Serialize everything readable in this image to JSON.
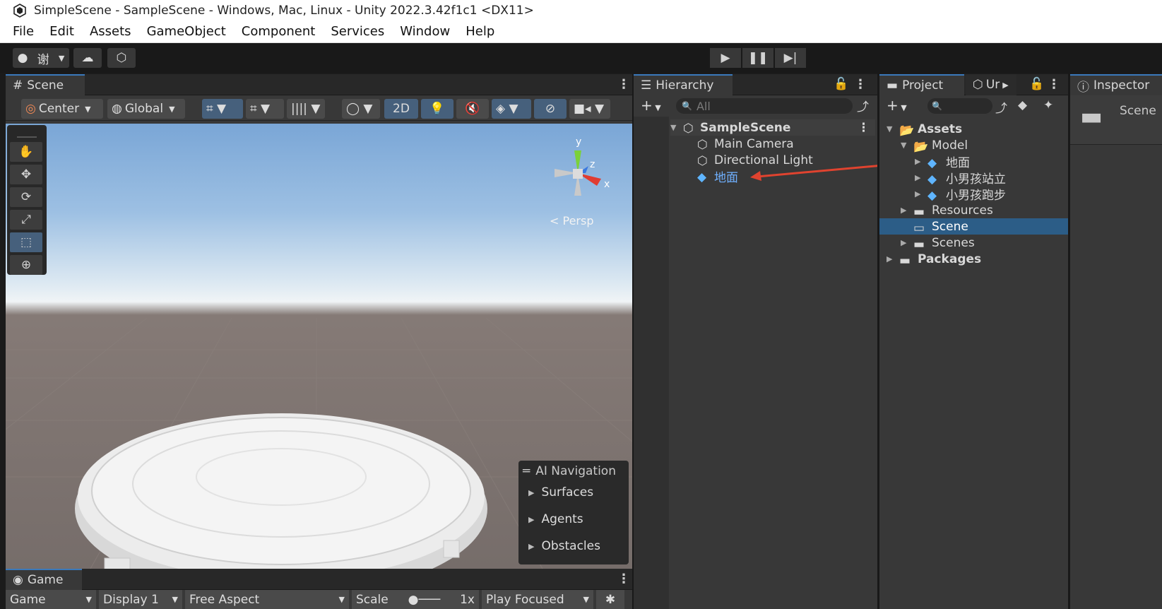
{
  "window": {
    "title": "SimpleScene - SampleScene - Windows, Mac, Linux - Unity 2022.3.42f1c1 <DX11>"
  },
  "menu": [
    "File",
    "Edit",
    "Assets",
    "GameObject",
    "Component",
    "Services",
    "Window",
    "Help"
  ],
  "toolbar": {
    "account_label": "谢"
  },
  "scene": {
    "tab": "Scene",
    "pivot": "Center",
    "space": "Global",
    "mode_2d": "2D",
    "persp": "< Persp",
    "gizmo": {
      "y": "y",
      "x": "x",
      "z": "z"
    },
    "ai_nav": {
      "title": "AI Navigation",
      "items": [
        "Surfaces",
        "Agents",
        "Obstacles"
      ]
    }
  },
  "game": {
    "tab": "Game",
    "view": "Game",
    "display": "Display 1",
    "aspect": "Free Aspect",
    "scale_label": "Scale",
    "scale_value": "1x",
    "play_mode": "Play Focused"
  },
  "hierarchy": {
    "tab": "Hierarchy",
    "search_placeholder": "All",
    "scene": "SampleScene",
    "items": [
      "Main Camera",
      "Directional Light",
      "地面"
    ]
  },
  "project": {
    "tab": "Project",
    "tab2": "Ur",
    "tree": {
      "assets": "Assets",
      "model": "Model",
      "models": [
        "地面",
        "小男孩站立",
        "小男孩跑步"
      ],
      "resources": "Resources",
      "scene": "Scene",
      "scenes": "Scenes",
      "packages": "Packages"
    }
  },
  "inspector": {
    "tab": "Inspector",
    "selected": "Scene"
  },
  "colors": {
    "selection": "#2c5d87",
    "accent": "#3a79bb",
    "arrow": "#e0432f",
    "hier_highlight": "#6fb0ff"
  }
}
